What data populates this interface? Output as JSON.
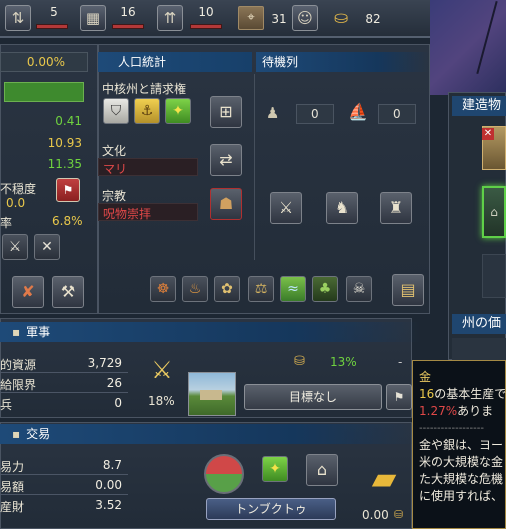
{
  "topbar": {
    "counters": [
      {
        "icon": "advisor-icon",
        "value": "5"
      },
      {
        "icon": "building-icon",
        "value": "16"
      },
      {
        "icon": "development-icon",
        "value": "10"
      }
    ],
    "map_value": "31",
    "gold_value": "82"
  },
  "left": {
    "percent": "0.00%",
    "values": [
      "0.41",
      "10.93",
      "11.35"
    ],
    "unrest_label": "不穏度",
    "unrest_value": "0.0",
    "rate_label": "率",
    "rate_value": "6.8%"
  },
  "population": {
    "header": "人口統計",
    "cores_label": "中核州と請求権",
    "culture_label": "文化",
    "culture_value": "マリ",
    "religion_label": "宗教",
    "religion_value": "呪物崇拝"
  },
  "standby": {
    "header": "待機列",
    "counts": [
      "0",
      "0"
    ]
  },
  "right_panel": {
    "header": "建造物",
    "state_value": "州の価"
  },
  "military": {
    "header": "軍事",
    "rows": [
      {
        "label": "的資源",
        "value": "3,729"
      },
      {
        "label": "給限界",
        "value": "26"
      },
      {
        "label": "兵",
        "value": "0"
      }
    ],
    "percent": "18%",
    "progress_value": "13%",
    "goal_button": "目標なし"
  },
  "trade": {
    "header": "交易",
    "rows": [
      {
        "label": "易力",
        "value": "8.7"
      },
      {
        "label": "易額",
        "value": "0.00"
      },
      {
        "label": "産財",
        "value": "3.52"
      }
    ],
    "node_button": "トンブクトゥ",
    "goods_value": "0.00"
  },
  "tooltip": {
    "title": "金",
    "line1_num": "16",
    "line1_text": "の基本生産で",
    "line2_num": "1.27%",
    "line2_text": "ありま",
    "divider": "------------------",
    "body": [
      "金や銀は、ヨー",
      "米の大規模な金",
      "た大規模な危機",
      "に使用すれば、"
    ]
  }
}
